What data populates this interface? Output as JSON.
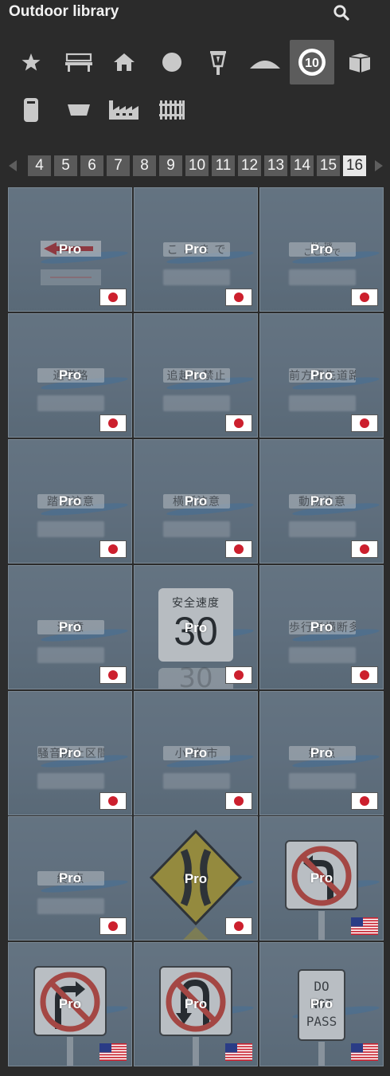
{
  "header": {
    "title": "Outdoor library",
    "search_icon": "search-icon"
  },
  "categories": [
    {
      "icon": "star-icon",
      "active": false
    },
    {
      "icon": "bench-icon",
      "active": false
    },
    {
      "icon": "house-icon",
      "active": false
    },
    {
      "icon": "circle-icon",
      "active": false
    },
    {
      "icon": "street-lamp-icon",
      "active": false
    },
    {
      "icon": "mound-icon",
      "active": false
    },
    {
      "icon": "speed-sign-icon",
      "label": "10",
      "active": true
    },
    {
      "icon": "box-icon",
      "active": false
    },
    {
      "icon": "bin-icon",
      "active": false
    },
    {
      "icon": "planter-icon",
      "active": false
    },
    {
      "icon": "factory-icon",
      "active": false
    },
    {
      "icon": "fence-icon",
      "active": false
    }
  ],
  "pager": {
    "pages": [
      "4",
      "5",
      "6",
      "7",
      "8",
      "9",
      "10",
      "11",
      "12",
      "13",
      "14",
      "15",
      "16"
    ],
    "current": "16",
    "prev_icon": "triangle-left-icon",
    "next_icon": "triangle-right-icon"
  },
  "tiles": [
    {
      "text": "",
      "badge": "Pro",
      "flag": "japan",
      "kind": "arrow"
    },
    {
      "text": "こ こ ま で",
      "badge": "Pro",
      "flag": "japan",
      "kind": "plate"
    },
    {
      "text": "区 域\nここまで",
      "badge": "Pro",
      "flag": "japan",
      "kind": "plate"
    },
    {
      "text": "通学路",
      "badge": "Pro",
      "flag": "japan",
      "kind": "plate"
    },
    {
      "text": "追越し禁止",
      "badge": "Pro",
      "flag": "japan",
      "kind": "plate"
    },
    {
      "text": "前方優先道路",
      "badge": "Pro",
      "flag": "japan",
      "kind": "plate"
    },
    {
      "text": "踏切注意",
      "badge": "Pro",
      "flag": "japan",
      "kind": "plate"
    },
    {
      "text": "横断注意",
      "badge": "Pro",
      "flag": "japan",
      "kind": "plate"
    },
    {
      "text": "動物注意",
      "badge": "Pro",
      "flag": "japan",
      "kind": "plate"
    },
    {
      "text": "注 意",
      "badge": "Pro",
      "flag": "japan",
      "kind": "plate"
    },
    {
      "text": "安全速度",
      "value": "30",
      "badge": "Pro",
      "flag": "japan",
      "kind": "speed"
    },
    {
      "text": "歩行者横断多し",
      "badge": "Pro",
      "flag": "japan",
      "kind": "plate"
    },
    {
      "text": "騒音防止区間",
      "badge": "Pro",
      "flag": "japan",
      "kind": "plate"
    },
    {
      "text": "小 諸 市",
      "badge": "Pro",
      "flag": "japan",
      "kind": "plate"
    },
    {
      "text": "始 点",
      "badge": "Pro",
      "flag": "japan",
      "kind": "plate"
    },
    {
      "text": "終 点",
      "badge": "Pro",
      "flag": "japan",
      "kind": "plate"
    },
    {
      "text": "",
      "badge": "Pro",
      "flag": "japan",
      "kind": "narrow-bridge"
    },
    {
      "text": "",
      "badge": "Pro",
      "flag": "usa",
      "kind": "no-left-turn"
    },
    {
      "text": "",
      "badge": "Pro",
      "flag": "usa",
      "kind": "no-right-turn"
    },
    {
      "text": "",
      "badge": "Pro",
      "flag": "usa",
      "kind": "no-u-turn"
    },
    {
      "text": "DO NOT PASS",
      "badge": "Pro",
      "flag": "usa",
      "kind": "do-not-pass"
    }
  ],
  "colors": {
    "background": "#2b2b2b",
    "tile": "#6a7a88",
    "active_category": "#5c5c5c",
    "page_button": "#5a5a5a",
    "page_current": "#e8e8e8"
  }
}
